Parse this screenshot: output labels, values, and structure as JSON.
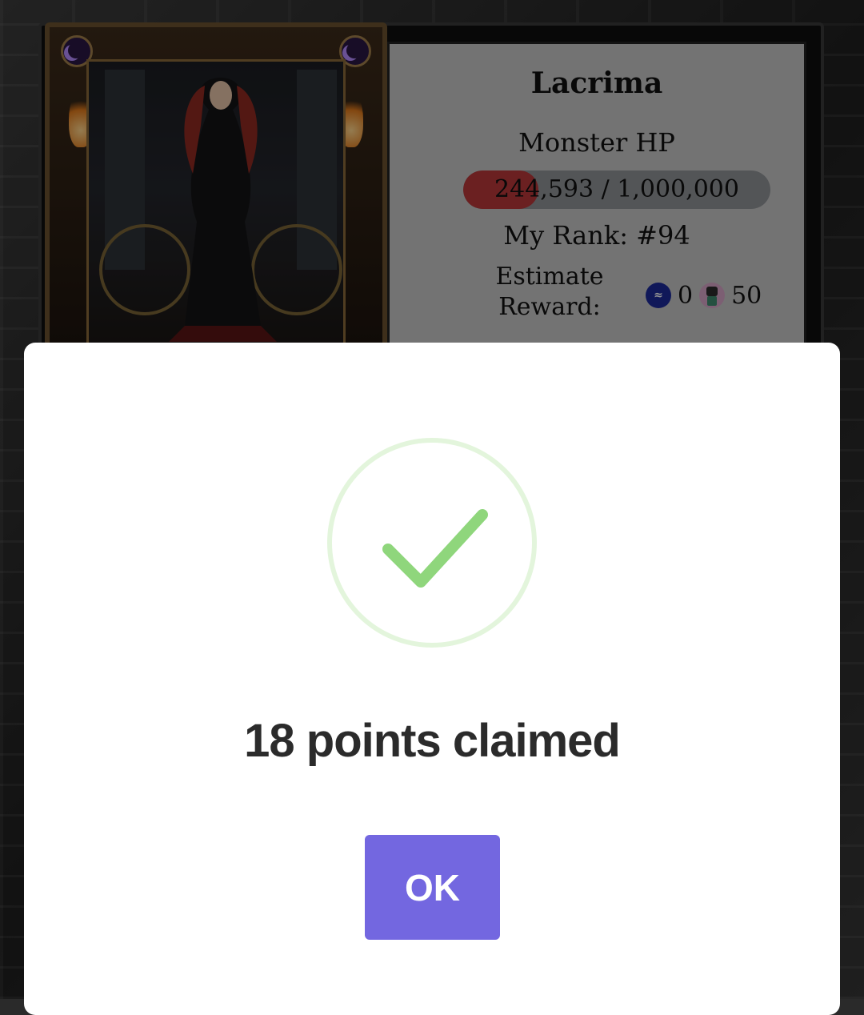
{
  "monster": {
    "name": "Lacrima",
    "hp_label": "Monster HP",
    "hp_current": 244593,
    "hp_max": 1000000,
    "hp_text": "244,593 / 1,000,000",
    "rank_text": "My Rank: #94",
    "reward_label": "Estimate Reward:",
    "reward_coin_value": "0",
    "reward_token_value": "50"
  },
  "dialog": {
    "message": "18 points claimed",
    "ok_label": "OK"
  },
  "colors": {
    "hp_fill": "#b8383a",
    "hp_bar": "#8f9397",
    "ok_button": "#7367e0",
    "check": "#8fd67c",
    "check_ring": "#e3f5dc"
  },
  "icons": {
    "coin": "steem-coin-icon",
    "token": "pixel-token-icon",
    "success": "check-circle-icon"
  }
}
